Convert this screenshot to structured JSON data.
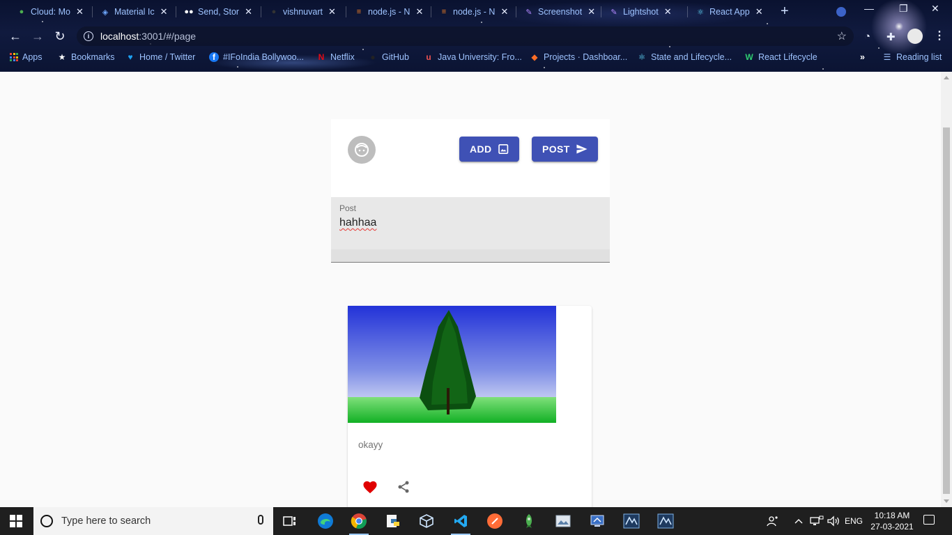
{
  "browser": {
    "tabs": [
      {
        "title": "Cloud: Mo",
        "icon": "mongodb-leaf-icon"
      },
      {
        "title": "Material Ic",
        "icon": "material-ui-icon"
      },
      {
        "title": "Send, Stor",
        "icon": "medium-icon"
      },
      {
        "title": "vishnuvart",
        "icon": "github-icon"
      },
      {
        "title": "node.js - N",
        "icon": "stackoverflow-icon"
      },
      {
        "title": "node.js - N",
        "icon": "stackoverflow-icon"
      },
      {
        "title": "Screenshot",
        "icon": "lightshot-feather-icon"
      },
      {
        "title": "Lightshot",
        "icon": "lightshot-feather-icon"
      },
      {
        "title": "React App",
        "icon": "react-icon"
      }
    ],
    "url_host": "localhost",
    "url_rest": ":3001/#/page",
    "bookmarks": [
      {
        "label": "Apps"
      },
      {
        "label": "Bookmarks"
      },
      {
        "label": "Home / Twitter"
      },
      {
        "label": "#IFoIndia Bollywoo..."
      },
      {
        "label": "Netflix"
      },
      {
        "label": "GitHub"
      },
      {
        "label": "Java University: Fro..."
      },
      {
        "label": "Projects · Dashboar..."
      },
      {
        "label": "State and Lifecycle..."
      },
      {
        "label": "React Lifecycle"
      }
    ],
    "reading_list": "Reading list",
    "overflow": "»"
  },
  "composer": {
    "add_label": "ADD",
    "post_label": "POST"
  },
  "post_field": {
    "label": "Post",
    "value": "hahhaa"
  },
  "card": {
    "caption": "okayy"
  },
  "taskbar": {
    "search_placeholder": "Type here to search",
    "language": "ENG",
    "time": "10:18 AM",
    "date": "27-03-2021"
  },
  "colors": {
    "primary": "#3f51b5",
    "like": "#e00000",
    "link_text": "#9ec3ff"
  }
}
